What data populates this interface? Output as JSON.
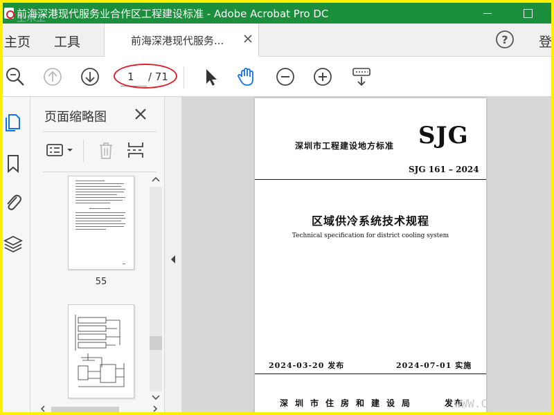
{
  "window": {
    "title": "前海深港现代服务业合作区工程建设标准 - Adobe Acrobat Pro DC",
    "watermark_top": "土木工"
  },
  "tabs": {
    "home": "主页",
    "tools": "工具",
    "document": "前海深港现代服务...",
    "signin": "登"
  },
  "toolbar": {
    "current_page": "1",
    "total_pages": "/ 71",
    "icons": [
      "zoom-search-icon",
      "previous-page-icon",
      "next-page-icon",
      "select-arrow-icon",
      "hand-tool-icon",
      "zoom-out-icon",
      "zoom-in-icon",
      "keyboard-scroll-icon"
    ]
  },
  "thumb_panel": {
    "title": "页面缩略图",
    "page_labels": [
      "55"
    ]
  },
  "document": {
    "org": "深圳市工程建设地方标准",
    "logo": "SJG",
    "code": "SJG 161 – 2024",
    "title_cn": "区域供冷系统技术规程",
    "title_en": "Technical specification for district cooling system",
    "issue_date": "2024-03-20 发布",
    "impl_date": "2024-07-01 实施",
    "publisher": "深圳市住房和建设局",
    "publish": "发布",
    "watermark": "WWW.C"
  },
  "colors": {
    "titlebar": "#1b8f3c",
    "frame_border": "#ffef00",
    "highlight_circle": "#e0202a",
    "active_icon": "#1473e6"
  }
}
